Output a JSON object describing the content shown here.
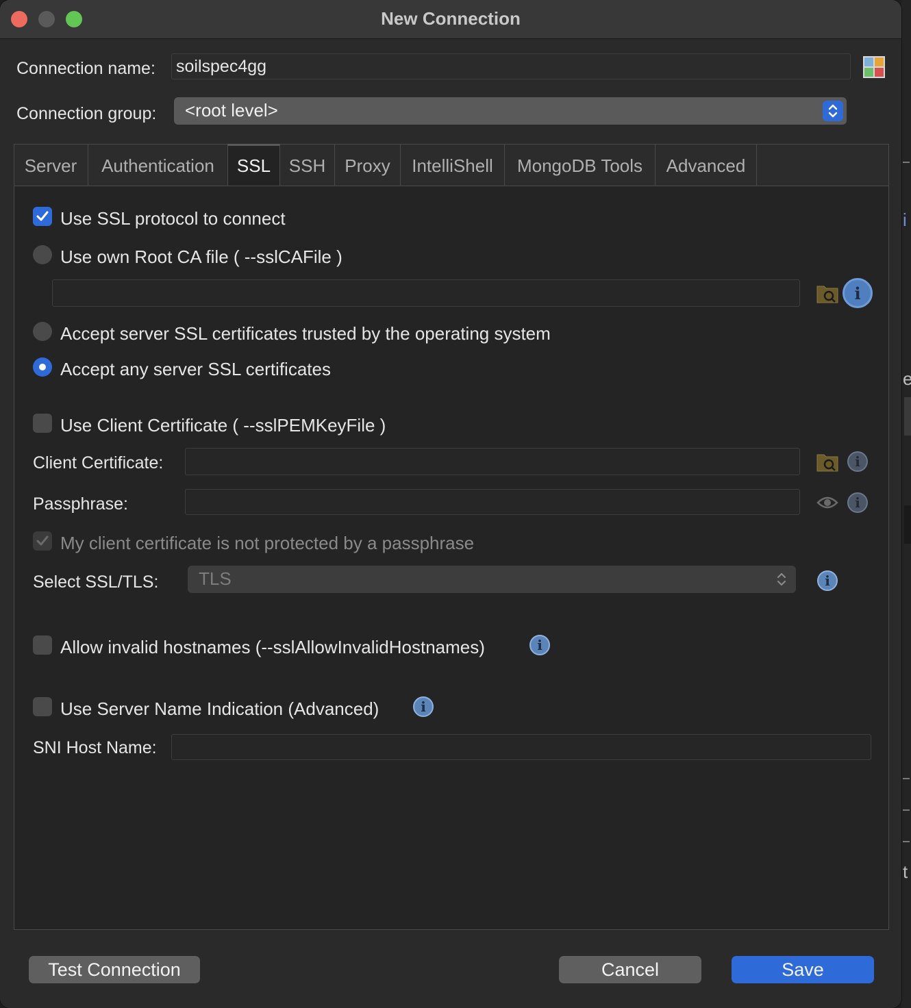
{
  "window": {
    "title": "New Connection"
  },
  "form": {
    "connection_name_label": "Connection name:",
    "connection_name_value": "soilspec4gg",
    "connection_group_label": "Connection group:",
    "connection_group_value": "<root level>"
  },
  "tabs": [
    {
      "label": "Server"
    },
    {
      "label": "Authentication"
    },
    {
      "label": "SSL",
      "active": true
    },
    {
      "label": "SSH"
    },
    {
      "label": "Proxy"
    },
    {
      "label": "IntelliShell"
    },
    {
      "label": "MongoDB Tools"
    },
    {
      "label": "Advanced"
    }
  ],
  "ssl": {
    "use_ssl_label": "Use SSL protocol to connect",
    "use_ssl_checked": true,
    "root_ca_label": "Use own Root CA file ( --sslCAFile )",
    "root_ca_path": "",
    "accept_os_label": "Accept server SSL certificates trusted by the operating system",
    "accept_any_label": "Accept any server SSL certificates",
    "selected_trust_option": "accept_any",
    "client_cert_label": "Use Client Certificate ( --sslPEMKeyFile )",
    "client_cert_checked": false,
    "client_certificate_label": "Client Certificate:",
    "client_certificate_value": "",
    "passphrase_label": "Passphrase:",
    "passphrase_value": "",
    "no_passphrase_label": "My client certificate is not protected by a passphrase",
    "no_passphrase_checked": true,
    "select_tls_label": "Select SSL/TLS:",
    "select_tls_value": "TLS",
    "allow_invalid_label": "Allow invalid hostnames (--sslAllowInvalidHostnames)",
    "allow_invalid_checked": false,
    "sni_label": "Use Server Name Indication (Advanced)",
    "sni_checked": false,
    "sni_host_label": "SNI Host Name:",
    "sni_host_value": ""
  },
  "buttons": {
    "test": "Test Connection",
    "cancel": "Cancel",
    "save": "Save"
  },
  "colors": {
    "accent": "#2f6bd8",
    "close": "#ed6a5e",
    "minimize": "#5a5a5a",
    "zoom": "#62c554"
  },
  "background_fragments": [
    "i",
    "e",
    "t"
  ]
}
